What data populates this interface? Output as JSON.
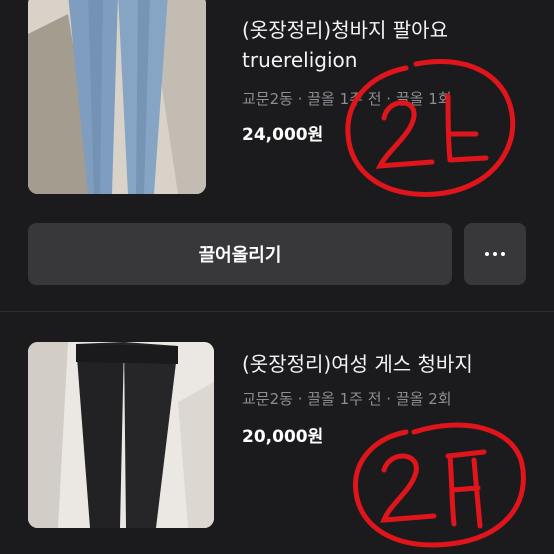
{
  "listings": [
    {
      "title_line1": "(옷장정리)청바지 팔아요",
      "title_line2": "truereligion",
      "meta": "교문2동 · 끌올 1주 전 · 끌올 1회",
      "price": "24,000원"
    },
    {
      "title_line1": "(옷장정리)여성 게스 청바지",
      "meta": "교문2동 · 끌올 1주 전 · 끌올 2회",
      "price": "20,000원"
    }
  ],
  "actions": {
    "bump_label": "끌어올리기",
    "more_icon": "more-horizontal-icon"
  },
  "colors": {
    "background": "#1b1b1d",
    "button": "#38383b",
    "meta_text": "#8d8d92",
    "annotation": "#e0141b"
  }
}
